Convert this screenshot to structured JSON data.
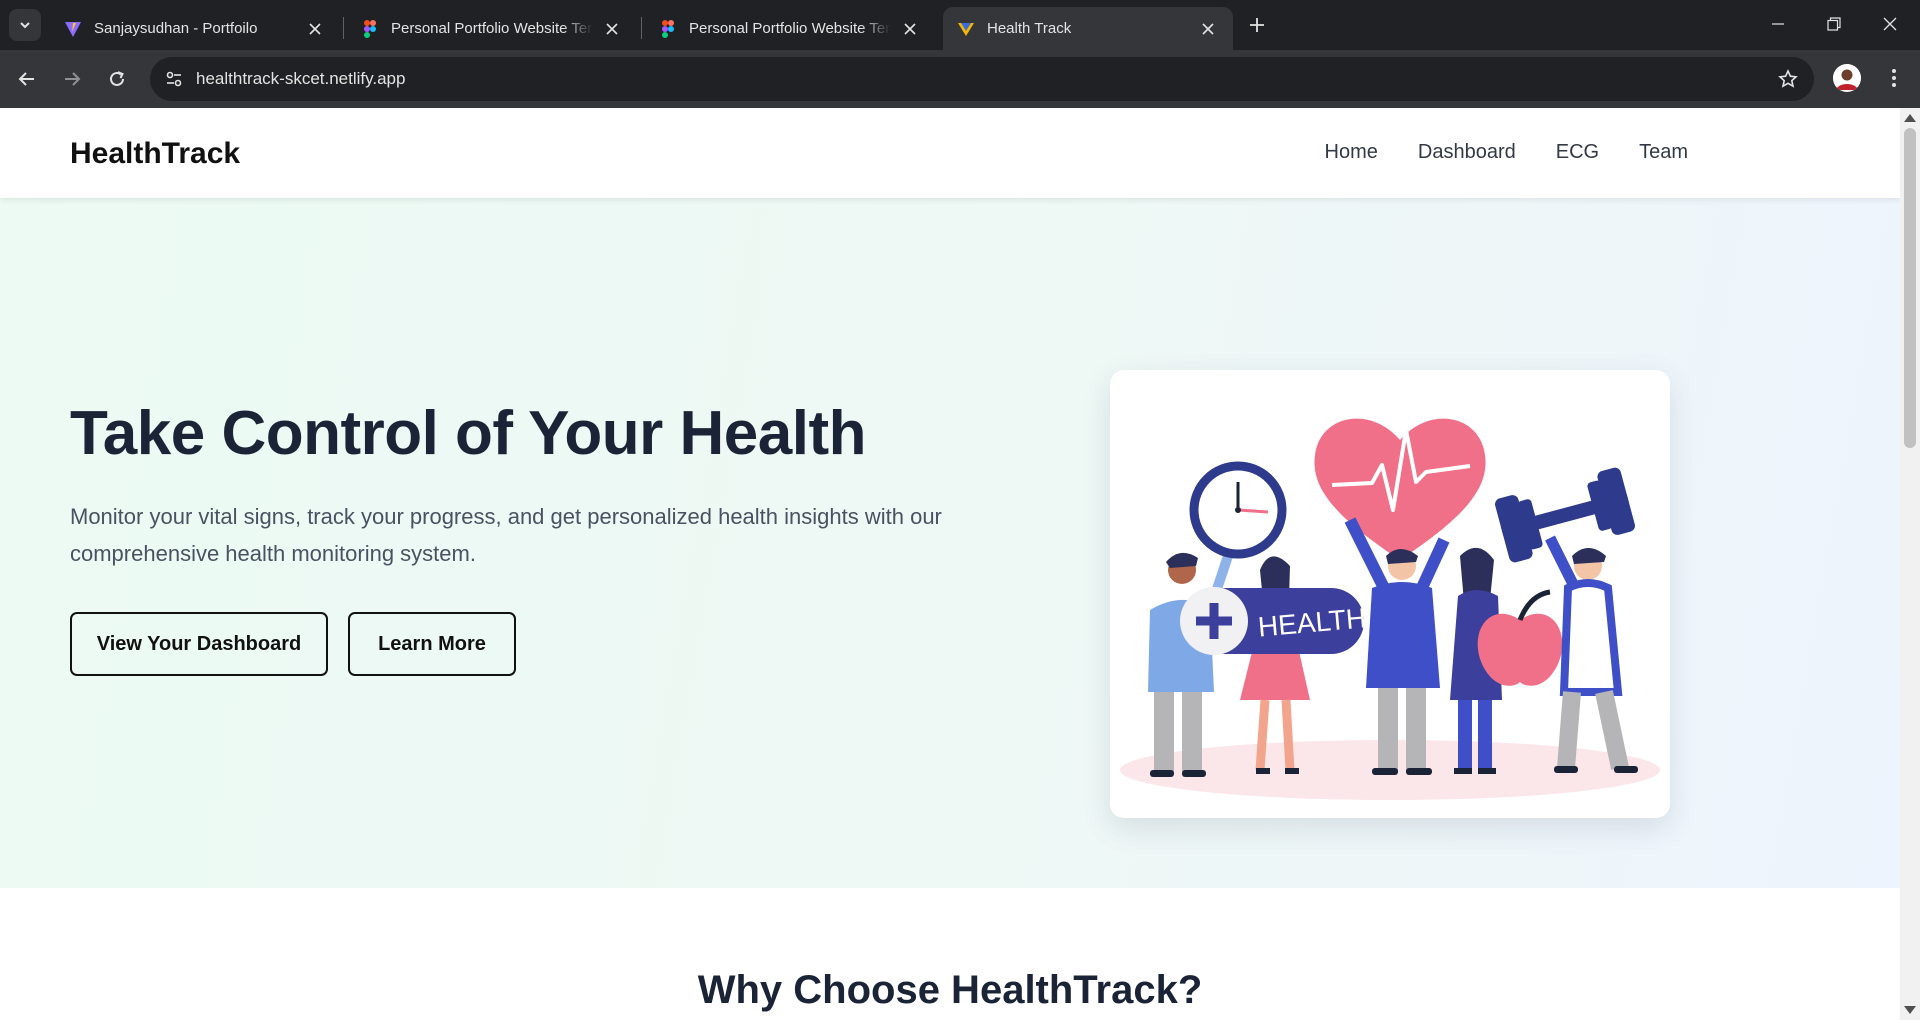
{
  "browser": {
    "tabs": [
      {
        "title": "Sanjaysudhan - Portfoilo",
        "icon": "vite-icon"
      },
      {
        "title": "Personal Portfolio Website Temp",
        "icon": "figma-icon"
      },
      {
        "title": "Personal Portfolio Website Temp",
        "icon": "figma-icon"
      },
      {
        "title": "Health Track",
        "icon": "vite-icon",
        "active": true
      }
    ],
    "url": "healthtrack-skcet.netlify.app"
  },
  "site": {
    "brand": "HealthTrack",
    "nav": [
      "Home",
      "Dashboard",
      "ECG",
      "Team"
    ]
  },
  "hero": {
    "title": "Take Control of Your Health",
    "subtitle": "Monitor your vital signs, track your progress, and get personalized health insights with our comprehensive health monitoring system.",
    "primary_button": "View Your Dashboard",
    "secondary_button": "Learn More",
    "illustration_label": "HEALTH"
  },
  "section": {
    "why_title": "Why Choose HealthTrack?"
  },
  "colors": {
    "accent_pink": "#f07089",
    "accent_indigo": "#3c3f9c",
    "text_dark": "#1b2436"
  }
}
